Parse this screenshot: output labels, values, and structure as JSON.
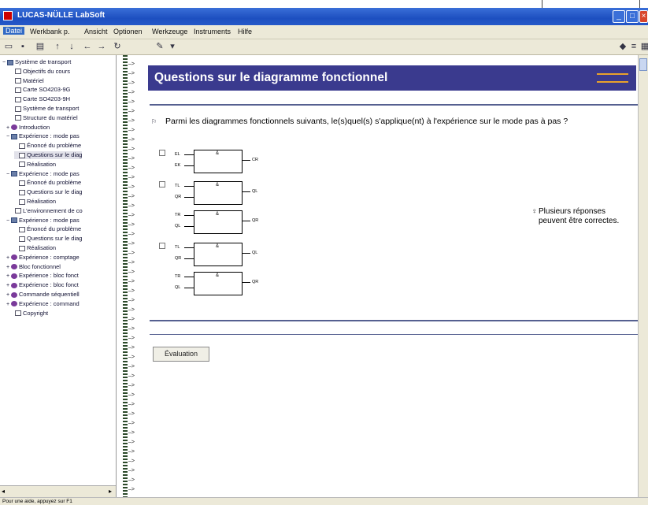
{
  "window": {
    "title": "LUCAS-NÜLLE LabSoft",
    "brand_color": "#3a3a8e",
    "accent_color": "#e8a12c"
  },
  "menu": [
    "Datei",
    "Werkbank p.",
    "Ansicht",
    "Optionen",
    "Werkzeuge",
    "Instruments",
    "Hilfe"
  ],
  "toolbar_icons": [
    "folder-icon",
    "save-icon",
    "print-icon",
    "up-arrow-icon",
    "down-arrow-icon",
    "back-icon",
    "forward-icon",
    "refresh-icon",
    "pencil-icon",
    "dropdown-icon",
    "marker-icon",
    "list-icon",
    "grid-icon"
  ],
  "tree": [
    {
      "label": "Système de transport",
      "icon": "book",
      "indent": 0,
      "expander": "−"
    },
    {
      "label": "Objectifs du cours",
      "icon": "page",
      "indent": 2
    },
    {
      "label": "Matériel",
      "icon": "page",
      "indent": 2
    },
    {
      "label": "Carte SO4203-9G",
      "icon": "page",
      "indent": 2
    },
    {
      "label": "Carte SO4203-9H",
      "icon": "page",
      "indent": 2
    },
    {
      "label": "Système de transport",
      "icon": "page",
      "indent": 2
    },
    {
      "label": "Structure du matériel",
      "icon": "page",
      "indent": 2
    },
    {
      "label": "Introduction",
      "icon": "ball",
      "indent": 1,
      "expander": "+"
    },
    {
      "label": "Expérience : mode pas",
      "icon": "book",
      "indent": 1,
      "expander": "−"
    },
    {
      "label": "Énoncé du problème",
      "icon": "page",
      "indent": 3
    },
    {
      "label": "Questions sur le diag",
      "icon": "page",
      "indent": 3,
      "selected": true
    },
    {
      "label": "Réalisation",
      "icon": "page",
      "indent": 3
    },
    {
      "label": "Expérience : mode pas",
      "icon": "book",
      "indent": 1,
      "expander": "−"
    },
    {
      "label": "Énoncé du problème",
      "icon": "page",
      "indent": 3
    },
    {
      "label": "Questions sur le diag",
      "icon": "page",
      "indent": 3
    },
    {
      "label": "Réalisation",
      "icon": "page",
      "indent": 3
    },
    {
      "label": "L'environnement de co",
      "icon": "page",
      "indent": 2
    },
    {
      "label": "Expérience : mode pas",
      "icon": "book",
      "indent": 1,
      "expander": "−"
    },
    {
      "label": "Énoncé du problème",
      "icon": "page",
      "indent": 3
    },
    {
      "label": "Questions sur le diag",
      "icon": "page",
      "indent": 3
    },
    {
      "label": "Réalisation",
      "icon": "page",
      "indent": 3
    },
    {
      "label": "Expérience : comptage",
      "icon": "ball",
      "indent": 1,
      "expander": "+"
    },
    {
      "label": "Bloc fonctionnel",
      "icon": "ball",
      "indent": 1,
      "expander": "+"
    },
    {
      "label": "Expérience : bloc fonct",
      "icon": "ball",
      "indent": 1,
      "expander": "+"
    },
    {
      "label": "Expérience : bloc fonct",
      "icon": "ball",
      "indent": 1,
      "expander": "+"
    },
    {
      "label": "Commande séquentiell",
      "icon": "ball",
      "indent": 1,
      "expander": "+"
    },
    {
      "label": "Expérience : command",
      "icon": "ball",
      "indent": 1,
      "expander": "+"
    },
    {
      "label": "Copyright",
      "icon": "page",
      "indent": 2
    }
  ],
  "page": {
    "title": "Questions sur le diagramme fonctionnel",
    "question": "Parmi les diagrammes fonctionnels suivants, le(s)quel(s) s'applique(nt) à l'expérience sur le mode pas à pas ?",
    "hint": "Plusieurs réponses peuvent être correctes.",
    "evaluate_button": "Évaluation"
  },
  "diagrams": [
    {
      "option": 1,
      "blocks": [
        {
          "inputs": [
            "EL",
            "EK"
          ],
          "op": "&",
          "output": "CR"
        }
      ]
    },
    {
      "option": 2,
      "blocks": [
        {
          "inputs": [
            "TL",
            "QR"
          ],
          "op": "&",
          "output": "QL"
        },
        {
          "inputs": [
            "TR",
            "QL"
          ],
          "op": "&",
          "output": "QR"
        }
      ]
    },
    {
      "option": 3,
      "blocks": [
        {
          "inputs": [
            "TL",
            "QR"
          ],
          "op": "&",
          "output": "QL"
        },
        {
          "inputs": [
            "TR",
            "QL"
          ],
          "op": "&",
          "output": "QR"
        }
      ]
    }
  ],
  "status": "Pour une aide, appuyez sur F1"
}
